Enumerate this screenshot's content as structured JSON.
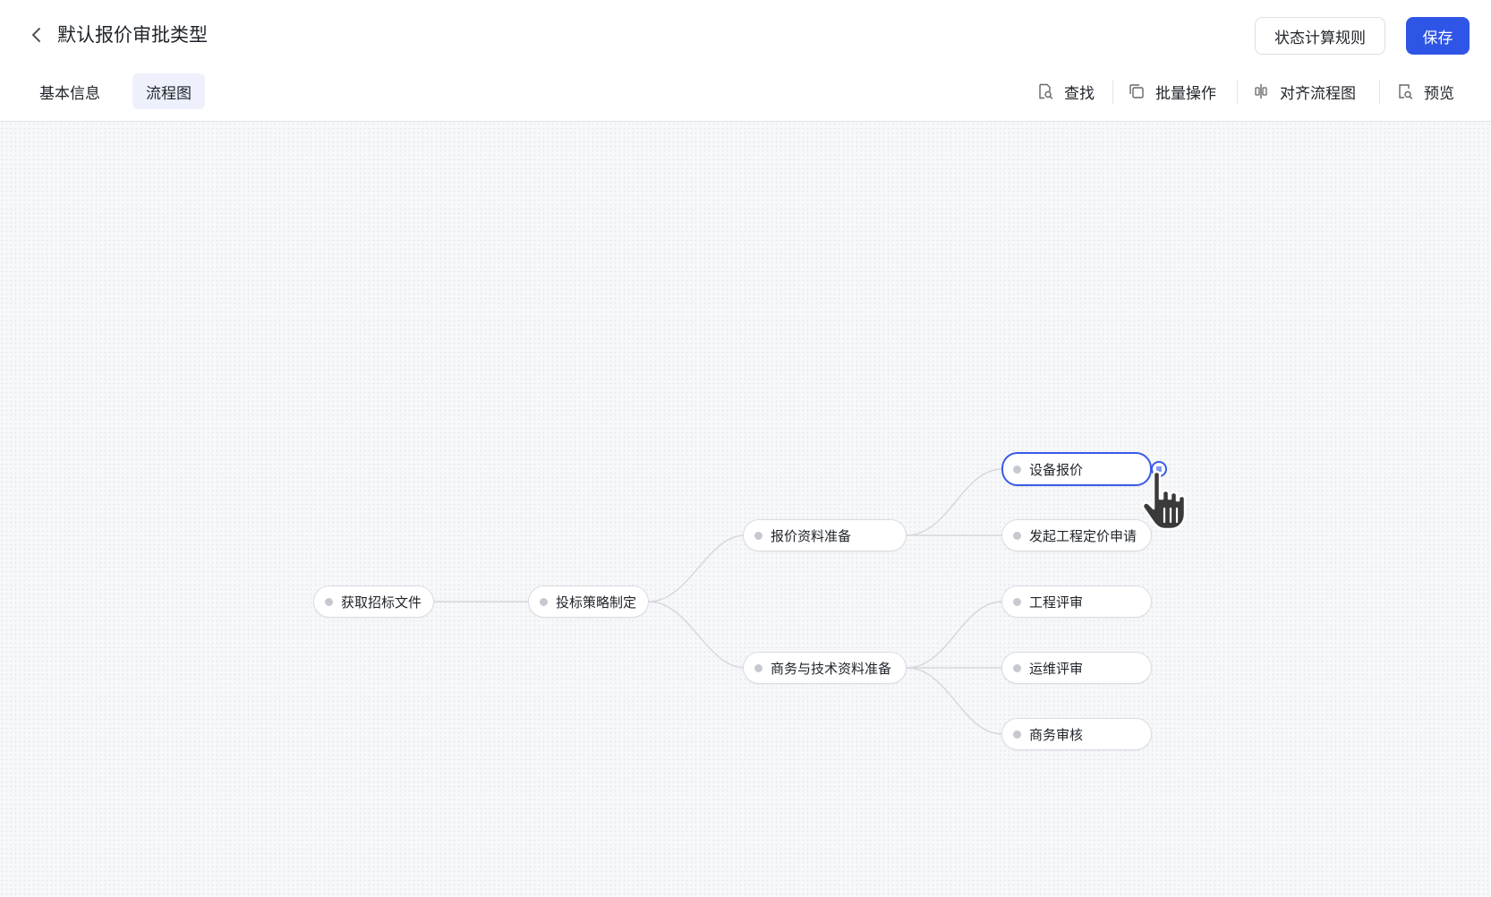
{
  "header": {
    "title": "默认报价审批类型",
    "rules_button": "状态计算规则",
    "save_button": "保存"
  },
  "tabs": [
    {
      "label": "基本信息",
      "active": false
    },
    {
      "label": "流程图",
      "active": true
    }
  ],
  "toolbar": {
    "find": "查找",
    "batch": "批量操作",
    "align": "对齐流程图",
    "preview": "预览"
  },
  "flow": {
    "nodes": {
      "n1": "获取招标文件",
      "n2": "投标策略制定",
      "n3": "报价资料准备",
      "n4": "商务与技术资料准备",
      "n5": "设备报价",
      "n6": "发起工程定价申请",
      "n7": "工程评审",
      "n8": "运维评审",
      "n9": "商务审核"
    },
    "selected_node": "设备报价"
  },
  "colors": {
    "accent": "#2f55e6",
    "selected_border": "#3a5be6",
    "active_tab_bg": "#eef1fc"
  },
  "icons": [
    "chevron-left-icon",
    "find-icon",
    "copy-icon",
    "align-icon",
    "preview-icon",
    "node-action-icon",
    "hand-cursor-icon"
  ]
}
